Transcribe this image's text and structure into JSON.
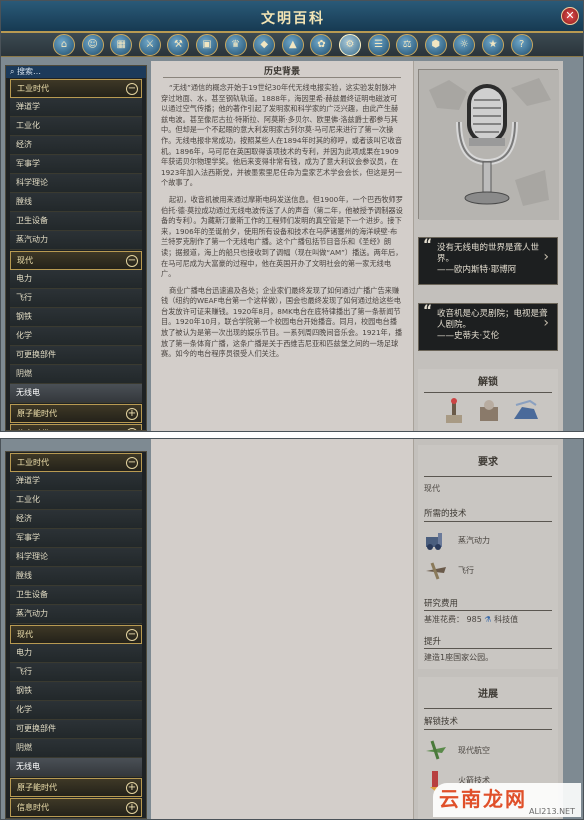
{
  "window": {
    "title": "文明百科",
    "close_glyph": "✕"
  },
  "category_icons": [
    "home-icon",
    "people-icon",
    "city-icon",
    "unit-icon",
    "improvement-icon",
    "building-icon",
    "wonder-icon",
    "resource-icon",
    "terrain-icon",
    "feature-icon",
    "tech-icon",
    "civic-icon",
    "government-icon",
    "district-icon",
    "religion-icon",
    "great-person-icon",
    "concept-icon"
  ],
  "search": {
    "label": "搜索…"
  },
  "sidebar": {
    "items": [
      {
        "label": "工业时代",
        "type": "era"
      },
      {
        "label": "弹道学",
        "type": "tech"
      },
      {
        "label": "工业化",
        "type": "tech"
      },
      {
        "label": "经济",
        "type": "tech"
      },
      {
        "label": "军事学",
        "type": "tech"
      },
      {
        "label": "科学理论",
        "type": "tech"
      },
      {
        "label": "膛线",
        "type": "tech"
      },
      {
        "label": "卫生设备",
        "type": "tech"
      },
      {
        "label": "蒸汽动力",
        "type": "tech"
      },
      {
        "label": "现代",
        "type": "era-open"
      },
      {
        "label": "电力",
        "type": "tech"
      },
      {
        "label": "飞行",
        "type": "tech"
      },
      {
        "label": "钢铁",
        "type": "tech"
      },
      {
        "label": "化学",
        "type": "tech"
      },
      {
        "label": "可更换部件",
        "type": "tech"
      },
      {
        "label": "阴燃",
        "type": "tech"
      },
      {
        "label": "无线电",
        "type": "tech-selected"
      },
      {
        "label": "原子能时代",
        "type": "era-closed"
      },
      {
        "label": "信息时代",
        "type": "era-closed"
      }
    ],
    "toggle_open": "−",
    "toggle_closed": "+"
  },
  "article": {
    "heading": "历史背景",
    "paragraphs": [
      "“无线”通信的概念开始于19世纪30年代无线电报实验，这实验发射脉冲穿过地面、水，甚至钢轨轨道。1888年，海因里希·赫兹最终证明电磁波可以通过空气传播；他的著作引起了发明家和科学家的广泛兴趣，由此产生赫兹电波。甚至像尼古拉·特斯拉、阿莫斯·多贝尔、欧里佛·洛兹爵士都参与其中。但却是一个不起眼的意大利发明家古列尔莫·马可尼来进行了第一次操作。无线电报非常成功，按照某些人在1894年时其的称呼，或者该叫它收音机。1896年，马可尼在英国取得该项技术的专利，并因为此项成果在1909年获诺贝尔物理学奖。他后来变得非常有钱，成为了意大利议会参议员，在1923年加入法西斯党，并被墨索里尼任命为皇家艺术学会会长，但这是另一个故事了。",
      "起初，收音机被用来通过摩斯电码发送信息。但1900年，一个巴西牧师罗伯托·德·莫拉成功通过无线电波传送了人的声音（第二年，他被授予调制器设备的专利）。为藏斯汀豪斯工作的工程师们发明的真空管是下一个进步。接下来，1906年的圣诞前夕，使用所有设备和技术在马萨诸塞州的海洋峡壁·布兰特罗克制作了第一个无线电广播。这个广播包括节目音乐和《圣经》朗读；据报道，海上的船只也接收到了调幅（现在叫做“AM”）播送。两年后，在马可尼成为大富豪的过程中，他在英国开办了文明社会的第一家无线电广。",
      "商业广播电台迅速遍及各处；企业家们最终发现了如何通过广播广告来赚钱（纽约的WEAF电台第一个这样做），国会也最终发现了如何通过给这些电台发放许可证来赚钱。1920年8月，8MK电台在底特律播出了第一条新闻节目。1920年10月，联合学院第一个校园电台开始播音。同月，校园电台播放了被认为是第一次出现的娱乐节目。一系列周四晚间音乐会。1921年，播放了第一条体育广播，这条广播是关于西维吉尼亚和匹兹堡之间的一场足球赛。如今的电台程序员很受人们关注。"
    ]
  },
  "quotes": [
    {
      "text": "没有无线电的世界是聋人世界。",
      "author": "——欧内斯特·耶博阿"
    },
    {
      "text": "收音机是心灵剧院；电视是聋人剧院。",
      "author": "——史蒂夫·艾伦"
    }
  ],
  "unlocks_heading": "解锁",
  "requirements": {
    "heading": "要求",
    "era": "现代",
    "required_label": "所需的技术",
    "required_techs": [
      "蒸汽动力",
      "飞行"
    ],
    "cost_label": "研究费用",
    "cost_text": "基准花费：",
    "cost_value": "985",
    "cost_unit": "科技值",
    "boost_label": "提升",
    "boost_text": "建造1座国家公园。"
  },
  "progression": {
    "heading": "进展",
    "unlock_label": "解锁技术",
    "unlock_techs": [
      "现代航空",
      "火箭技术"
    ]
  },
  "watermark": {
    "cn": "云南龙网",
    "en": "ALI213.NET"
  },
  "colors": {
    "accent_gold": "#b89a52",
    "titlebar_blue": "#1f4d6d",
    "quote_bg": "#1d1f20",
    "article_bg": "#d3ceca"
  }
}
